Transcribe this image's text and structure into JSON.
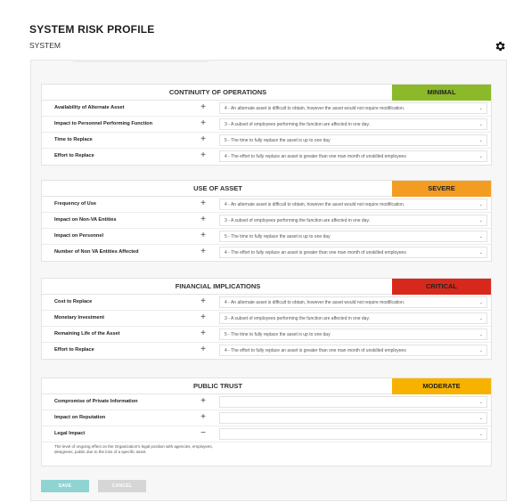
{
  "header": {
    "title": "SYSTEM RISK PROFILE",
    "subtitle": "SYSTEM"
  },
  "icons": {
    "settings": "gear-icon",
    "add": "plus",
    "collapse": "minus",
    "dropdown": "caret"
  },
  "colors": {
    "minimal": "#8bb92a",
    "severe": "#f39c22",
    "critical": "#d8281c",
    "moderate": "#f7b200"
  },
  "sections": [
    {
      "title": "CONTINUITY OF OPERATIONS",
      "badge": "MINIMAL",
      "rows": [
        {
          "label": "Availability of Alternate Asset",
          "toggle": "+",
          "value": "4 - An alternate asset is difficult to obtain, however the asset would not require modification."
        },
        {
          "label": "Impact to Personnel Performing Function",
          "toggle": "+",
          "value": "3 - A subset of employees performing the function are affected in one day."
        },
        {
          "label": "Time to Replace",
          "toggle": "+",
          "value": "5 - The time to fully replace the asset is up to one day"
        },
        {
          "label": "Effort to Replace",
          "toggle": "+",
          "value": "4 - The effort to fully replace an asset is greater than one man month of unskilled employees"
        }
      ]
    },
    {
      "title": "USE OF ASSET",
      "badge": "SEVERE",
      "rows": [
        {
          "label": "Frequency of Use",
          "toggle": "+",
          "value": "4 - An alternate asset is difficult to obtain, however the asset would not require modification."
        },
        {
          "label": "Impact on Non-VA Entities",
          "toggle": "+",
          "value": "3 - A subset of employees performing the function are affected in one day."
        },
        {
          "label": "Impact on Personnel",
          "toggle": "+",
          "value": "5 - The time to fully replace the asset is up to one day"
        },
        {
          "label": "Number of Non VA Entities Affected",
          "toggle": "+",
          "value": "4 - The effort to fully replace an asset is greater than one man month of unskilled employees"
        }
      ]
    },
    {
      "title": "FINANCIAL IMPLICATIONS",
      "badge": "CRITICAL",
      "rows": [
        {
          "label": "Cost to Replace",
          "toggle": "+",
          "value": "4 - An alternate asset is difficult to obtain, however the asset would not require modification."
        },
        {
          "label": "Monetary Investment",
          "toggle": "+",
          "value": "3 - A subset of employees performing the function are affected in one day."
        },
        {
          "label": "Remaining Life of the Asset",
          "toggle": "+",
          "value": "5 - The time to fully replace the asset is up to one day"
        },
        {
          "label": "Effort to Replace",
          "toggle": "+",
          "value": "4 - The effort to fully replace an asset is greater than one man month of unskilled employees"
        }
      ]
    },
    {
      "title": "PUBLIC TRUST",
      "badge": "MODERATE",
      "rows": [
        {
          "label": "Compromise of Private Information",
          "toggle": "+",
          "value": ""
        },
        {
          "label": "Impact on Reputation",
          "toggle": "+",
          "value": ""
        },
        {
          "label": "Legal Impact",
          "toggle": "−",
          "value": ""
        }
      ],
      "note": "The level of ongoing effect on the Organization's legal position with agencies, employees, designees, public due to the loss of a specific asset."
    }
  ],
  "buttons": {
    "save": "SAVE",
    "cancel": "CANCEL"
  }
}
